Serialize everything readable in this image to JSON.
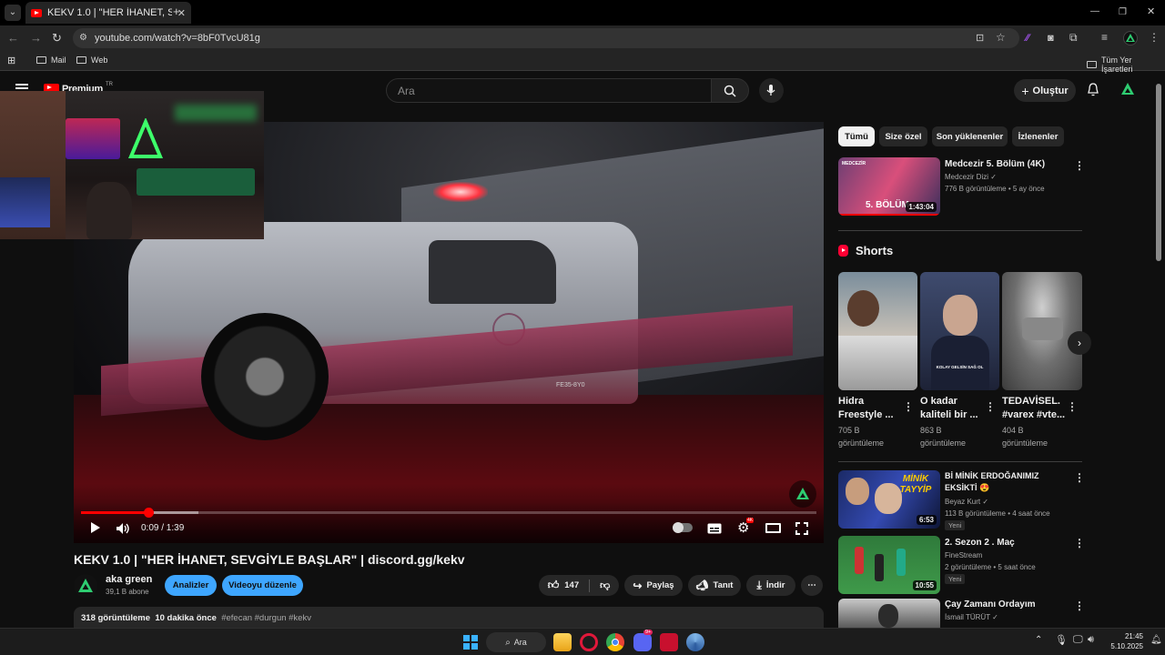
{
  "browser": {
    "tab_title": "KEKV 1.0 | \"HER İHANET, SEVGİ",
    "url": "youtube.com/watch?v=8bF0TvcU81g",
    "bookmarks": [
      "Mail",
      "Web"
    ],
    "all_bookmarks": "Tüm Yer İşaretleri"
  },
  "header": {
    "logo": "Premium",
    "region": "TR",
    "search_placeholder": "Ara",
    "create_label": "Oluştur"
  },
  "player": {
    "current_time": "0:09",
    "duration": "1:39",
    "time_display": "0:09 / 1:39",
    "progress_fraction": 0.091,
    "buffered_fraction": 0.16,
    "ambulance_text": "FE35-8Y0"
  },
  "video": {
    "title": "KEKV 1.0 | \"HER İHANET, SEVGİYLE BAŞLAR\" | discord.gg/kekv",
    "channel": "aka green",
    "subscribers": "39,1 B abone",
    "analytics_label": "Analizler",
    "edit_label": "Videoyu düzenle",
    "likes": "147",
    "share_label": "Paylaş",
    "promote_label": "Tanıt",
    "download_label": "İndir",
    "views": "318 görüntüleme",
    "age": "10 dakika önce",
    "hashtags": "#efecan #durgun #kekv"
  },
  "sidebar": {
    "chips": [
      "Tümü",
      "Size özel",
      "Son yüklenenler",
      "İzlenenler"
    ],
    "top_video": {
      "title": "Medcezir 5. Bölüm (4K)",
      "channel": "Medcezir Dizi",
      "meta": "776 B görüntüleme • 5 ay önce",
      "duration": "1:43:04",
      "thumb_text": "5. BÖLÜM",
      "thumb_logo": "MEDCEZİR"
    },
    "shorts_heading": "Shorts",
    "shorts": [
      {
        "title": "Hidra Freestyle ...",
        "views": "705 B görüntüleme",
        "overlay": ""
      },
      {
        "title": "O kadar kaliteli bir ...",
        "views": "863 B görüntüleme",
        "overlay": "KOLAY GELSİN SAĞ OL"
      },
      {
        "title": "TEDAVİSEL. #varex #vte...",
        "views": "404 B görüntüleme",
        "overlay": ""
      }
    ],
    "videos": [
      {
        "title": "Bİ MİNİK ERDOĞANIMIZ EKSİKTİ 😍",
        "channel": "Beyaz Kurt",
        "meta": "113 B görüntüleme • 4 saat önce",
        "badge": "Yeni",
        "duration": "6:53",
        "thumb_text": "MİNİK TAYYİP"
      },
      {
        "title": "2. Sezon 2 . Maç",
        "channel": "FineStream",
        "meta": "2 görüntüleme • 5 saat önce",
        "badge": "Yeni",
        "duration": "10:55"
      },
      {
        "title": "Çay Zamanı Ordayım",
        "channel": "İsmail TÜRÜT",
        "meta": "",
        "badge": "",
        "duration": ""
      }
    ]
  },
  "taskbar": {
    "search_label": "Ara",
    "time": "21:45",
    "date": "5.10.2025",
    "discord_badge": "9+"
  },
  "colors": {
    "accent_red": "#ff0000",
    "blue_button": "#3ea6ff",
    "channel_green": "#2ecc71"
  }
}
